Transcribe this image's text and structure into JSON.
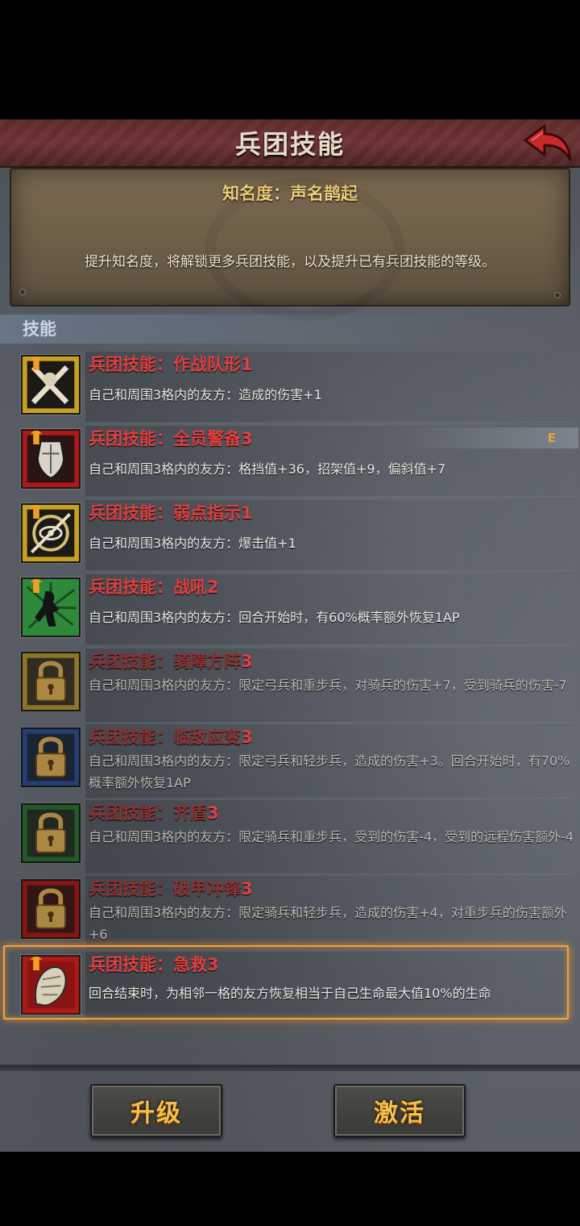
{
  "header": {
    "title": "兵团技能"
  },
  "fame": {
    "label": "知名度：声名鹊起",
    "description": "提升知名度，将解锁更多兵团技能，以及提升已有兵团技能的等级。"
  },
  "section": {
    "label": "技能"
  },
  "skills": [
    {
      "title": "兵团技能：作战队形",
      "level": "1",
      "desc": "自己和周围3格内的友方：造成的伤害+1",
      "icon": "crossed-swords-icon",
      "locked": false
    },
    {
      "title": "兵团技能：全员警备",
      "level": "3",
      "desc": "自己和周围3格内的友方：格挡值+36，招架值+9，偏斜值+7",
      "icon": "shield-icon",
      "locked": false
    },
    {
      "title": "兵团技能：弱点指示",
      "level": "1",
      "desc": "自己和周围3格内的友方：爆击值+1",
      "icon": "eye-target-icon",
      "locked": false
    },
    {
      "title": "兵团技能：战吼",
      "level": "2",
      "desc": "自己和周围3格内的友方：回合开始时，有60%概率额外恢复1AP",
      "icon": "warcry-icon",
      "locked": false
    },
    {
      "title": "兵团技能：骑障方阵",
      "level": "3",
      "desc": "自己和周围3格内的友方：限定弓兵和重步兵，对骑兵的伤害+7，受到骑兵的伤害-7",
      "icon": "padlock-icon",
      "locked": true
    },
    {
      "title": "兵团技能：临敌应变",
      "level": "3",
      "desc": "自己和周围3格内的友方：限定弓兵和轻步兵，造成的伤害+3。回合开始时，有70%概率额外恢复1AP",
      "icon": "padlock-icon",
      "locked": true
    },
    {
      "title": "兵团技能：齐盾",
      "level": "3",
      "desc": "自己和周围3格内的友方：限定骑兵和重步兵，受到的伤害-4，受到的远程伤害额外-4",
      "icon": "padlock-icon",
      "locked": true
    },
    {
      "title": "兵团技能：破甲冲锋",
      "level": "3",
      "desc": "自己和周围3格内的友方：限定骑兵和轻步兵，造成的伤害+4，对重步兵的伤害额外+6",
      "icon": "padlock-icon",
      "locked": true
    },
    {
      "title": "兵团技能：急救",
      "level": "3",
      "desc": "回合结束时，为相邻一格的友方恢复相当于自己生命最大值10%的生命",
      "icon": "bandage-icon",
      "locked": false
    }
  ],
  "row_flag": "E",
  "buttons": {
    "upgrade": "升级",
    "activate": "激活"
  },
  "colors": {
    "skill_title": "#e04040",
    "fame_text": "#f2cf7a",
    "button_text": "#f3c04a",
    "highlight": "#f0a040"
  }
}
